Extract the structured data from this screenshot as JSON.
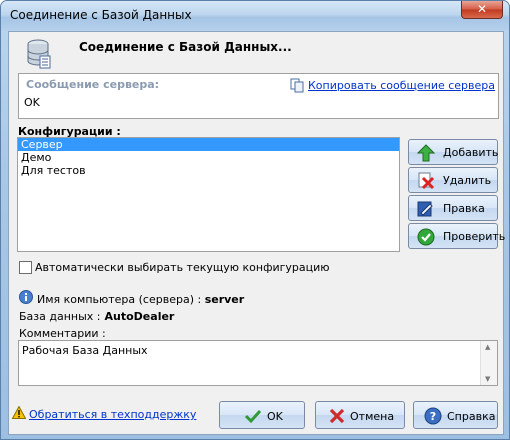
{
  "window": {
    "title": "Соединение с Базой Данных",
    "close_label": "✕"
  },
  "header": {
    "title": "Соединение с Базой Данных..."
  },
  "server_message": {
    "label": "Сообщение сервера:",
    "copy_link": "Копировать сообщение сервера",
    "text": "OK"
  },
  "configurations": {
    "label": "Конфигурации :",
    "items": [
      "Сервер",
      "Демо",
      "Для тестов"
    ],
    "selected_index": 0
  },
  "side_buttons": {
    "add": "Добавить",
    "delete": "Удалить",
    "edit": "Правка",
    "check": "Проверить"
  },
  "auto_select": {
    "label": "Автоматически выбирать текущую конфигурацию",
    "checked": false
  },
  "info": {
    "pc_label": "Имя компьютера (сервера) :",
    "pc_value": "server",
    "db_label": "База данных :",
    "db_value": "AutoDealer",
    "comment_label": "Комментарии :",
    "comment_text": "Рабочая База Данных"
  },
  "footer": {
    "support_link": "Обратиться в техподдержку",
    "ok": "OK",
    "cancel": "Отмена",
    "help": "Справка"
  },
  "colors": {
    "selection": "#3399ff",
    "link": "#0033cc"
  }
}
